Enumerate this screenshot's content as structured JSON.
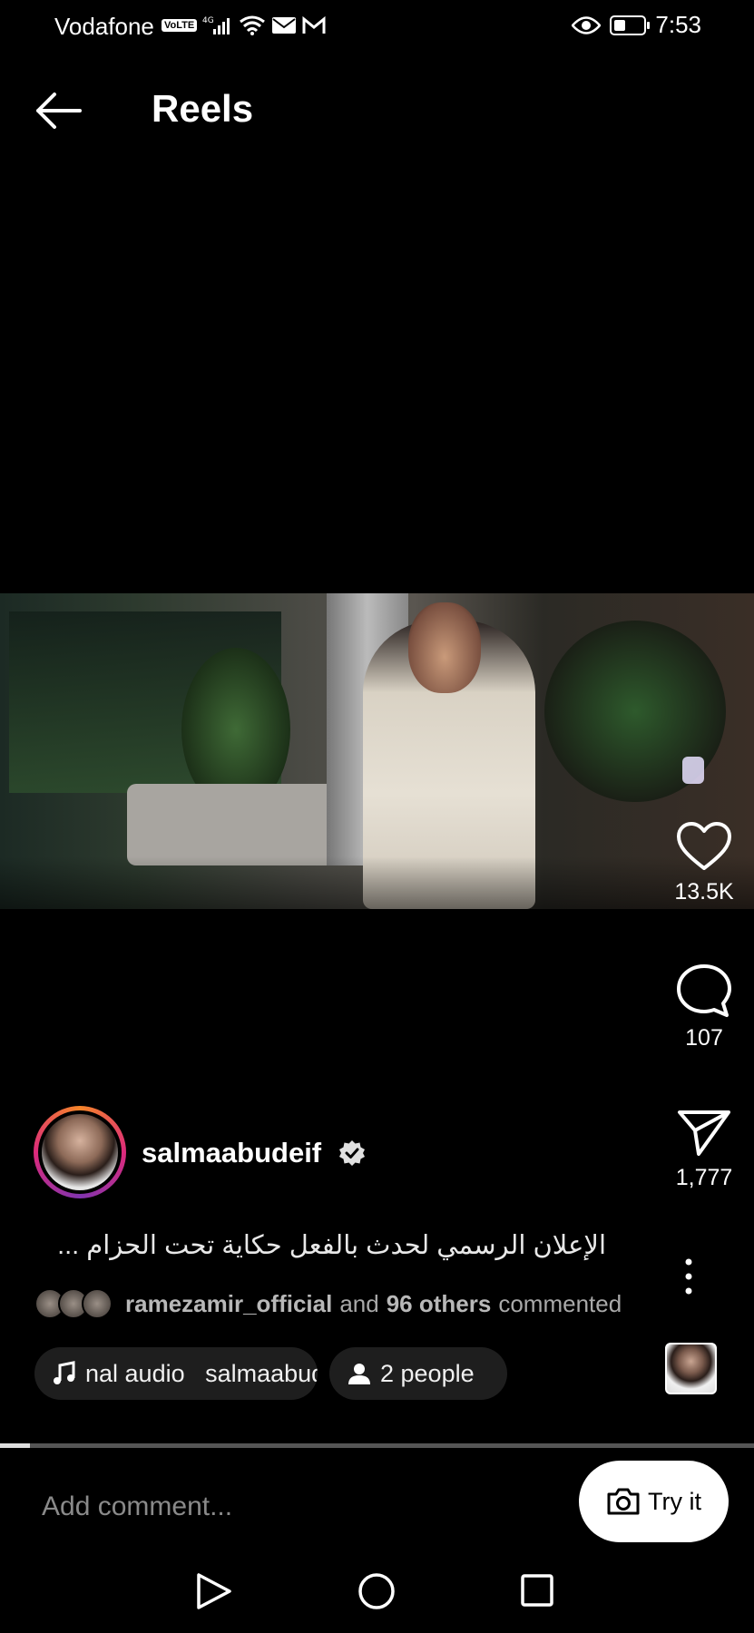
{
  "status_bar": {
    "carrier": "Vodafone",
    "volte": "VoLTE",
    "network": "4G",
    "time": "7:53",
    "battery_level_percent": 40
  },
  "header": {
    "title": "Reels"
  },
  "actions": {
    "likes": "13.5K",
    "comments": "107",
    "shares": "1,777"
  },
  "author": {
    "username": "salmaabudeif",
    "verified": true
  },
  "caption": "الإعلان الرسمي لحدث بالفعل حكاية تحت الحزام ...",
  "commented": {
    "user": "ramezamir_official",
    "and": "and",
    "others": "96 others",
    "suffix": "commented"
  },
  "audio_pill": {
    "text": "nal audio   salmaabudeif"
  },
  "people_pill": {
    "text": "2 people"
  },
  "progress": {
    "fraction": 0.04
  },
  "comment_bar": {
    "placeholder": "Add comment...",
    "try_label": "Try it"
  }
}
